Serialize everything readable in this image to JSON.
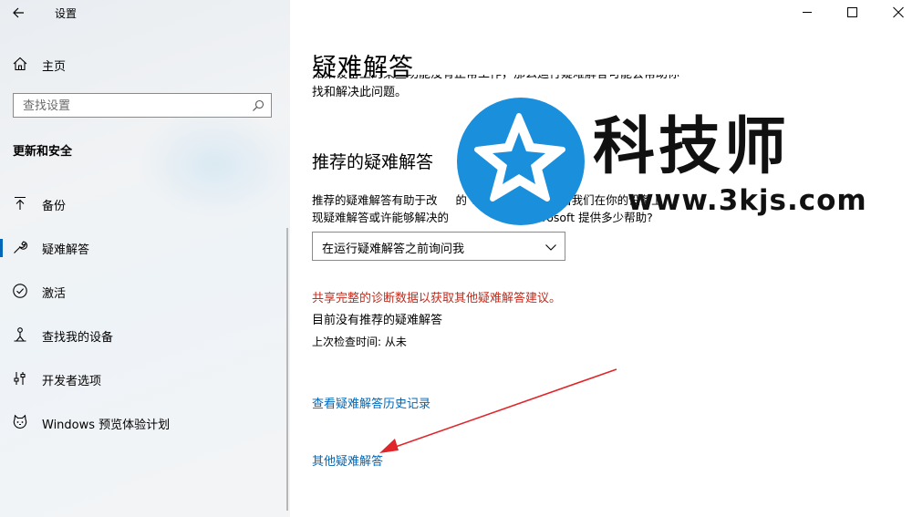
{
  "window": {
    "app_title": "设置",
    "controls": {
      "minimize": "minimize-icon",
      "maximize": "maximize-icon",
      "close": "close-icon"
    }
  },
  "sidebar": {
    "home_label": "主页",
    "search_placeholder": "查找设置",
    "section_heading": "更新和安全",
    "items": [
      {
        "label": "备份",
        "icon": "backup-arrow-icon"
      },
      {
        "label": "疑难解答",
        "icon": "wrench-icon",
        "active": true
      },
      {
        "label": "激活",
        "icon": "check-circle-icon"
      },
      {
        "label": "查找我的设备",
        "icon": "person-location-icon"
      },
      {
        "label": "开发者选项",
        "icon": "developer-sliders-icon"
      },
      {
        "label": "Windows 预览体验计划",
        "icon": "cat-icon"
      }
    ]
  },
  "main": {
    "title": "疑难解答",
    "intro_line1": "如果设备上的某些功能没有正常工作，那么运行疑难解答可能会帮助你",
    "intro_line2": "找和解决此问题。",
    "recommended_heading": "推荐的疑难解答",
    "desc_line1": "推荐的疑难解答有助于改",
    "desc_line1_b": "的 Windo",
    "desc_line1_c": "金。当我们在你的设备上",
    "desc_line2": "现疑难解答或许能够解决的",
    "desc_line2_b": "icrosoft 提供多少帮助?",
    "dropdown_value": "在运行疑难解答之前询问我",
    "warning": "共享完整的诊断数据以获取其他疑难解答建议。",
    "status": "目前没有推荐的疑难解答",
    "last_check": "上次检查时间: 从未",
    "history_link": "查看疑难解答历史记录",
    "other_link": "其他疑难解答"
  },
  "watermark": {
    "brand": "科技师",
    "url": "www.3kjs.com",
    "logo": "star-logo-icon",
    "logo_color": "#1a8fdc"
  },
  "annotation": {
    "arrow_color": "#e0262a",
    "arrow": "red-arrow"
  },
  "colors": {
    "accent": "#0067b8",
    "warning": "#c42b1c"
  }
}
